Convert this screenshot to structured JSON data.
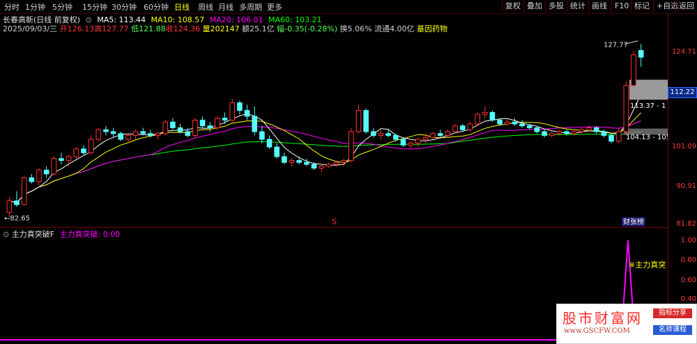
{
  "toolbar": {
    "timeframes": [
      "分时",
      "1分钟",
      "5分钟",
      "15分钟",
      "30分钟",
      "60分钟",
      "日线",
      "周线",
      "月线",
      "多周期",
      "更多"
    ],
    "active_timeframe": "日线",
    "buttons": [
      "复权",
      "叠加",
      "多股",
      "统计",
      "画线",
      "F10",
      "标记",
      "+自选",
      "返回"
    ]
  },
  "quote": {
    "stock_name": "长春高新(日线 前复权)",
    "ma5": "MA5: 113.44",
    "ma10": "MA10: 108.57",
    "ma20": "MA20: 106.01",
    "ma60": "MA60: 103.21",
    "date": "2025/09/03/三",
    "open": "开126.13",
    "high": "高127.77",
    "low": "低121.88",
    "close": "收124.36",
    "volume": "量202147",
    "amount": "额25.1亿",
    "change": "幅-0.35(-0.28%)",
    "turnover": "换5.06%",
    "float_cap": "流通4.00亿",
    "concept": "基因药物"
  },
  "price_axis": {
    "ticks": [
      "124.71",
      "112.22",
      "101.09",
      "90.91",
      "81.82"
    ],
    "current_price": "112.22"
  },
  "annotations": {
    "high_label": "127.77",
    "low_label": "82.65",
    "box_upper": "113.37 - 1",
    "box_lower": "104.13 - 105",
    "mid_marker": "S",
    "news_tag": "财张榜"
  },
  "indicator": {
    "name": "主力真突破F",
    "series_label": "主力真突破: 0.00",
    "signal_label": "※主力真突",
    "ticks": [
      "1.00",
      "0.80",
      "0.60",
      "0.40"
    ]
  },
  "watermark": {
    "title": "股市财富网",
    "url": "www.GSCFW.COM",
    "tag1": "指标分享",
    "tag2": "名师课程"
  },
  "colors": {
    "up": "#ff3232",
    "down": "#54ffff",
    "ma5": "#ffffff",
    "ma10": "#ffff00",
    "ma20": "#ff00ff",
    "ma60": "#00ff00"
  },
  "chart_data": {
    "type": "candlestick",
    "ylim": [
      81.82,
      130
    ],
    "candles": [
      {
        "o": 84.0,
        "h": 88.0,
        "l": 82.65,
        "c": 87.0
      },
      {
        "o": 87.0,
        "h": 89.5,
        "l": 85.5,
        "c": 86.0
      },
      {
        "o": 86.0,
        "h": 93.5,
        "l": 85.8,
        "c": 93.0
      },
      {
        "o": 93.0,
        "h": 94.0,
        "l": 91.5,
        "c": 92.0
      },
      {
        "o": 92.0,
        "h": 95.5,
        "l": 91.0,
        "c": 95.0
      },
      {
        "o": 95.0,
        "h": 96.0,
        "l": 93.0,
        "c": 94.0
      },
      {
        "o": 94.0,
        "h": 98.5,
        "l": 93.5,
        "c": 98.0
      },
      {
        "o": 98.0,
        "h": 99.5,
        "l": 96.5,
        "c": 97.5
      },
      {
        "o": 97.5,
        "h": 99.0,
        "l": 96.0,
        "c": 98.5
      },
      {
        "o": 98.5,
        "h": 101.0,
        "l": 98.0,
        "c": 100.5
      },
      {
        "o": 100.5,
        "h": 101.5,
        "l": 99.0,
        "c": 99.5
      },
      {
        "o": 99.5,
        "h": 104.0,
        "l": 99.0,
        "c": 103.0
      },
      {
        "o": 103.0,
        "h": 106.0,
        "l": 102.5,
        "c": 105.5
      },
      {
        "o": 105.5,
        "h": 106.5,
        "l": 104.0,
        "c": 105.0
      },
      {
        "o": 105.0,
        "h": 106.0,
        "l": 103.5,
        "c": 104.5
      },
      {
        "o": 104.5,
        "h": 105.0,
        "l": 102.5,
        "c": 103.0
      },
      {
        "o": 103.0,
        "h": 104.5,
        "l": 102.0,
        "c": 104.0
      },
      {
        "o": 104.0,
        "h": 105.5,
        "l": 103.0,
        "c": 105.0
      },
      {
        "o": 105.0,
        "h": 106.0,
        "l": 104.0,
        "c": 104.5
      },
      {
        "o": 104.5,
        "h": 105.5,
        "l": 103.5,
        "c": 104.0
      },
      {
        "o": 104.0,
        "h": 105.0,
        "l": 103.0,
        "c": 104.5
      },
      {
        "o": 104.5,
        "h": 108.0,
        "l": 104.0,
        "c": 107.5
      },
      {
        "o": 107.5,
        "h": 108.5,
        "l": 105.5,
        "c": 106.0
      },
      {
        "o": 106.0,
        "h": 107.0,
        "l": 104.5,
        "c": 105.0
      },
      {
        "o": 105.0,
        "h": 106.0,
        "l": 103.5,
        "c": 104.0
      },
      {
        "o": 104.0,
        "h": 108.5,
        "l": 103.5,
        "c": 108.0
      },
      {
        "o": 108.0,
        "h": 109.0,
        "l": 106.0,
        "c": 106.5
      },
      {
        "o": 106.5,
        "h": 107.5,
        "l": 105.0,
        "c": 106.0
      },
      {
        "o": 106.0,
        "h": 109.0,
        "l": 105.5,
        "c": 108.5
      },
      {
        "o": 108.5,
        "h": 110.0,
        "l": 107.0,
        "c": 108.0
      },
      {
        "o": 108.0,
        "h": 113.5,
        "l": 107.5,
        "c": 112.5
      },
      {
        "o": 112.5,
        "h": 113.0,
        "l": 109.5,
        "c": 110.5
      },
      {
        "o": 110.5,
        "h": 112.0,
        "l": 108.0,
        "c": 109.0
      },
      {
        "o": 109.0,
        "h": 111.5,
        "l": 104.0,
        "c": 105.0
      },
      {
        "o": 105.0,
        "h": 106.5,
        "l": 102.0,
        "c": 103.0
      },
      {
        "o": 103.0,
        "h": 104.0,
        "l": 100.5,
        "c": 101.0
      },
      {
        "o": 101.0,
        "h": 102.0,
        "l": 98.0,
        "c": 98.5
      },
      {
        "o": 98.5,
        "h": 99.5,
        "l": 96.5,
        "c": 97.0
      },
      {
        "o": 97.0,
        "h": 98.0,
        "l": 96.0,
        "c": 97.5
      },
      {
        "o": 97.5,
        "h": 98.5,
        "l": 96.5,
        "c": 97.0
      },
      {
        "o": 97.0,
        "h": 98.0,
        "l": 96.0,
        "c": 96.5
      },
      {
        "o": 96.5,
        "h": 97.0,
        "l": 95.0,
        "c": 95.5
      },
      {
        "o": 95.5,
        "h": 96.5,
        "l": 94.5,
        "c": 96.0
      },
      {
        "o": 96.0,
        "h": 97.0,
        "l": 95.5,
        "c": 96.5
      },
      {
        "o": 96.5,
        "h": 97.5,
        "l": 96.0,
        "c": 97.0
      },
      {
        "o": 97.0,
        "h": 98.0,
        "l": 96.0,
        "c": 97.5
      },
      {
        "o": 97.5,
        "h": 106.0,
        "l": 97.0,
        "c": 105.0
      },
      {
        "o": 105.0,
        "h": 112.0,
        "l": 104.5,
        "c": 110.5
      },
      {
        "o": 110.5,
        "h": 111.0,
        "l": 104.5,
        "c": 105.0
      },
      {
        "o": 105.0,
        "h": 106.0,
        "l": 103.5,
        "c": 104.0
      },
      {
        "o": 104.0,
        "h": 105.5,
        "l": 103.0,
        "c": 104.5
      },
      {
        "o": 104.5,
        "h": 105.5,
        "l": 103.5,
        "c": 104.0
      },
      {
        "o": 104.0,
        "h": 104.5,
        "l": 102.5,
        "c": 103.0
      },
      {
        "o": 103.0,
        "h": 103.5,
        "l": 101.0,
        "c": 101.5
      },
      {
        "o": 101.5,
        "h": 102.5,
        "l": 100.5,
        "c": 102.0
      },
      {
        "o": 102.0,
        "h": 103.5,
        "l": 101.0,
        "c": 103.0
      },
      {
        "o": 103.0,
        "h": 104.0,
        "l": 102.0,
        "c": 103.5
      },
      {
        "o": 103.5,
        "h": 105.0,
        "l": 103.0,
        "c": 104.5
      },
      {
        "o": 104.5,
        "h": 105.5,
        "l": 103.5,
        "c": 104.0
      },
      {
        "o": 104.0,
        "h": 105.5,
        "l": 103.5,
        "c": 105.0
      },
      {
        "o": 105.0,
        "h": 107.0,
        "l": 104.5,
        "c": 106.5
      },
      {
        "o": 106.5,
        "h": 107.0,
        "l": 105.0,
        "c": 105.5
      },
      {
        "o": 105.5,
        "h": 107.5,
        "l": 105.0,
        "c": 107.0
      },
      {
        "o": 107.0,
        "h": 110.0,
        "l": 106.5,
        "c": 109.5
      },
      {
        "o": 109.5,
        "h": 111.5,
        "l": 108.5,
        "c": 110.0
      },
      {
        "o": 110.0,
        "h": 110.5,
        "l": 107.5,
        "c": 108.0
      },
      {
        "o": 108.0,
        "h": 108.5,
        "l": 106.5,
        "c": 107.0
      },
      {
        "o": 107.0,
        "h": 108.0,
        "l": 106.5,
        "c": 107.5
      },
      {
        "o": 107.5,
        "h": 108.5,
        "l": 106.5,
        "c": 107.0
      },
      {
        "o": 107.0,
        "h": 108.0,
        "l": 106.0,
        "c": 106.5
      },
      {
        "o": 106.5,
        "h": 107.0,
        "l": 105.5,
        "c": 106.0
      },
      {
        "o": 106.0,
        "h": 106.5,
        "l": 104.5,
        "c": 105.0
      },
      {
        "o": 105.0,
        "h": 105.5,
        "l": 103.5,
        "c": 104.0
      },
      {
        "o": 104.0,
        "h": 105.0,
        "l": 103.5,
        "c": 104.5
      },
      {
        "o": 104.5,
        "h": 105.5,
        "l": 104.0,
        "c": 105.0
      },
      {
        "o": 105.0,
        "h": 105.5,
        "l": 104.0,
        "c": 104.5
      },
      {
        "o": 104.5,
        "h": 105.5,
        "l": 104.0,
        "c": 105.0
      },
      {
        "o": 105.0,
        "h": 106.0,
        "l": 104.5,
        "c": 105.5
      },
      {
        "o": 105.5,
        "h": 106.5,
        "l": 105.0,
        "c": 106.0
      },
      {
        "o": 106.0,
        "h": 106.5,
        "l": 104.5,
        "c": 105.0
      },
      {
        "o": 105.0,
        "h": 105.5,
        "l": 103.5,
        "c": 104.0
      },
      {
        "o": 104.0,
        "h": 104.5,
        "l": 102.0,
        "c": 102.5
      },
      {
        "o": 102.5,
        "h": 106.0,
        "l": 102.0,
        "c": 105.0
      },
      {
        "o": 105.0,
        "h": 118.0,
        "l": 104.5,
        "c": 117.0
      },
      {
        "o": 117.0,
        "h": 126.0,
        "l": 116.5,
        "c": 125.0
      },
      {
        "o": 126.13,
        "h": 127.77,
        "l": 121.88,
        "c": 124.36
      }
    ]
  }
}
